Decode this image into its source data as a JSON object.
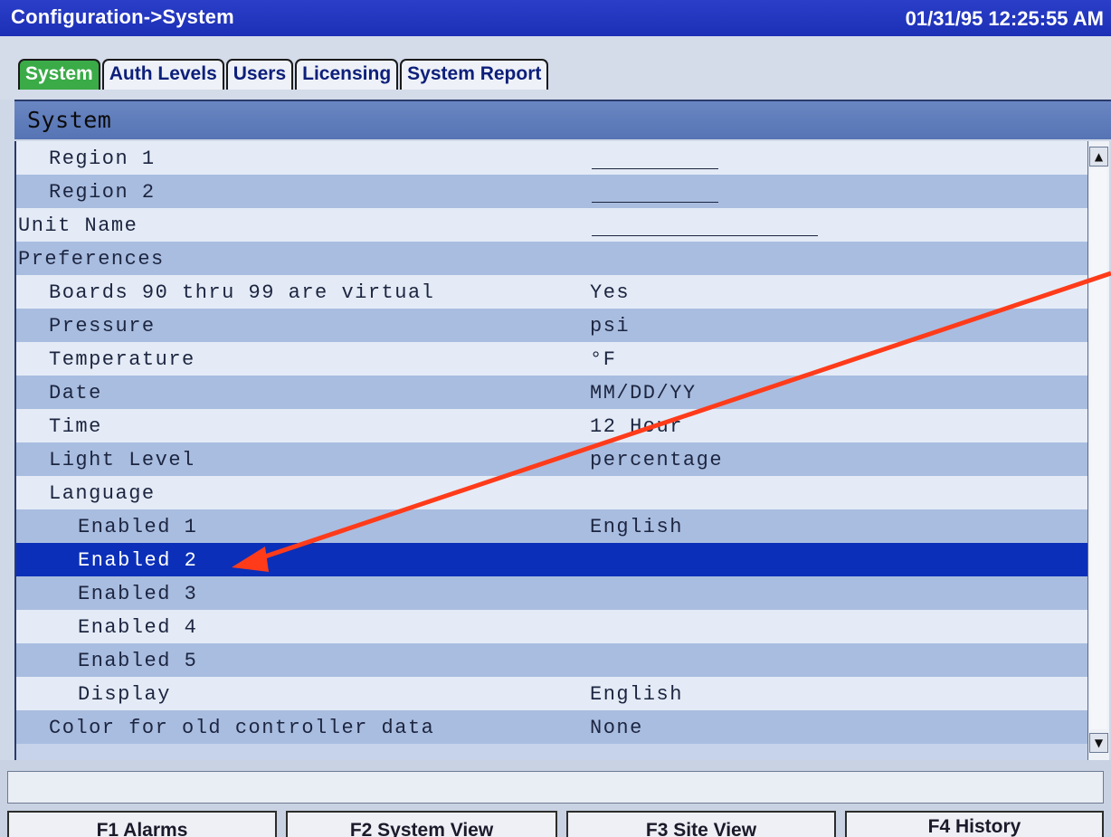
{
  "titlebar": {
    "title": "Configuration->System",
    "datetime": "01/31/95 12:25:55 AM"
  },
  "tabs": [
    {
      "label": "System",
      "active": true
    },
    {
      "label": "Auth Levels",
      "active": false
    },
    {
      "label": "Users",
      "active": false
    },
    {
      "label": "Licensing",
      "active": false
    },
    {
      "label": "System Report",
      "active": false
    }
  ],
  "panel": {
    "header": "System"
  },
  "rows": [
    {
      "label": "Region 1",
      "value": "",
      "indent": 1,
      "blank": "short"
    },
    {
      "label": "Region 2",
      "value": "",
      "indent": 1,
      "blank": "short"
    },
    {
      "label": "Unit Name",
      "value": "",
      "indent": 0,
      "blank": "long"
    },
    {
      "label": "Preferences",
      "value": "",
      "indent": 0
    },
    {
      "label": "Boards 90 thru 99 are virtual",
      "value": "Yes",
      "indent": 1
    },
    {
      "label": "Pressure",
      "value": "psi",
      "indent": 1
    },
    {
      "label": "Temperature",
      "value": "°F",
      "indent": 1
    },
    {
      "label": "Date",
      "value": "MM/DD/YY",
      "indent": 1
    },
    {
      "label": "Time",
      "value": "12 Hour",
      "indent": 1
    },
    {
      "label": "Light Level",
      "value": "percentage",
      "indent": 1
    },
    {
      "label": "Language",
      "value": "",
      "indent": 1
    },
    {
      "label": "Enabled 1",
      "value": "English",
      "indent": 2
    },
    {
      "label": "Enabled 2",
      "value": "",
      "indent": 2,
      "selected": true
    },
    {
      "label": "Enabled 3",
      "value": "",
      "indent": 2
    },
    {
      "label": "Enabled 4",
      "value": "",
      "indent": 2
    },
    {
      "label": "Enabled 5",
      "value": "",
      "indent": 2
    },
    {
      "label": "Display",
      "value": "English",
      "indent": 2
    },
    {
      "label": "Color for old controller data",
      "value": "None",
      "indent": 1
    }
  ],
  "scrollbar": {
    "up_icon": "triangle-up-icon",
    "up_glyph": "▲",
    "down_icon": "triangle-down-icon",
    "down_glyph": "▼"
  },
  "status_bar": {
    "text": ""
  },
  "function_keys": [
    {
      "label": "F1 Alarms"
    },
    {
      "label": "F2 System View"
    },
    {
      "label": "F3 Site View"
    },
    {
      "label": "F4 History"
    }
  ],
  "colors": {
    "titlebar": "#1c2fb6",
    "active_tab": "#3aab47",
    "selected_row": "#0b2fb8",
    "row_light": "#e4ebf6",
    "row_dark": "#a9bde0",
    "annotation_arrow": "#ff3b1a"
  }
}
